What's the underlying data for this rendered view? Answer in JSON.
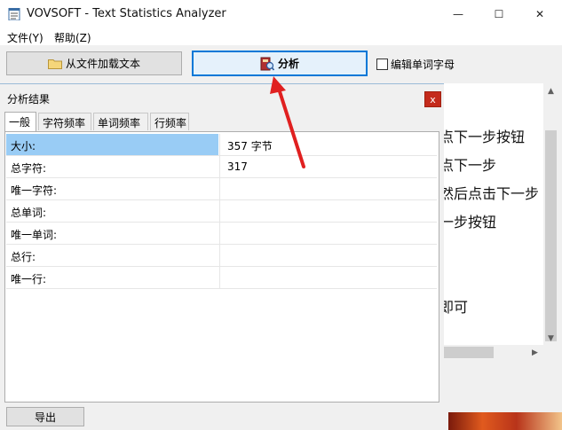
{
  "window": {
    "title": "VOVSOFT - Text Statistics Analyzer",
    "minimize_glyph": "—",
    "maximize_glyph": "☐",
    "close_glyph": "✕"
  },
  "menu": {
    "file": "文件(Y)",
    "help": "帮助(Z)"
  },
  "toolbar": {
    "load_label": "从文件加载文本",
    "analyze_label": "分析",
    "edit_word_label": "编辑单词字母",
    "edit_word_checked": false
  },
  "background_text": {
    "lines": [
      "点下一步按钮",
      "点下一步",
      "  然后点击下一步",
      "一步按钮",
      "即可"
    ]
  },
  "results": {
    "title": "分析结果",
    "close_glyph": "x",
    "tabs": [
      "一般",
      "字符频率",
      "单词频率",
      "行频率"
    ],
    "active_tab": 0,
    "rows": [
      {
        "key": "大小:",
        "value": "357 字节"
      },
      {
        "key": "总字符:",
        "value": "317"
      },
      {
        "key": "唯一字符:",
        "value": ""
      },
      {
        "key": "总单词:",
        "value": ""
      },
      {
        "key": "唯一单词:",
        "value": ""
      },
      {
        "key": "总行:",
        "value": ""
      },
      {
        "key": "唯一行:",
        "value": ""
      }
    ],
    "export_label": "导出"
  },
  "colors": {
    "accent": "#0078d7",
    "selection": "#99ccf5",
    "close_red": "#c42b1c",
    "annotation_arrow": "#e02020"
  }
}
